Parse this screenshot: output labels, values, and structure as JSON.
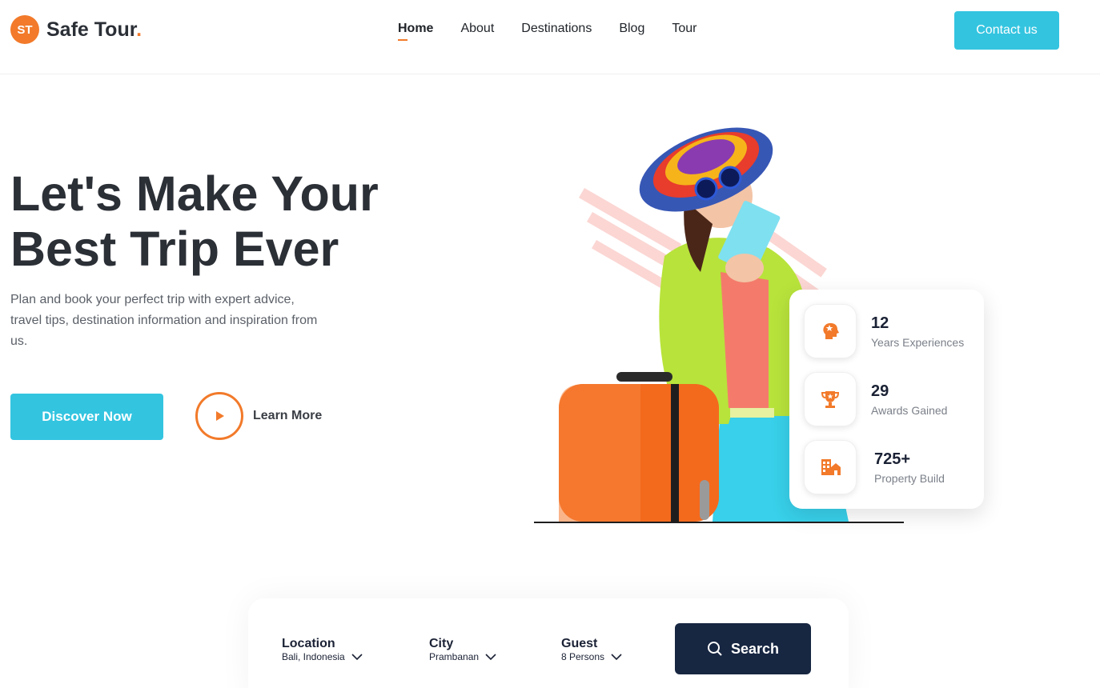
{
  "brand": {
    "badge": "ST",
    "name": "Safe Tour",
    "dot": ".",
    "accent": "#f27a2a",
    "primary": "#33c4e0",
    "dark": "#172641"
  },
  "nav": {
    "items": [
      {
        "label": "Home",
        "active": true
      },
      {
        "label": "About"
      },
      {
        "label": "Destinations"
      },
      {
        "label": "Blog"
      },
      {
        "label": "Tour"
      }
    ]
  },
  "header": {
    "contact_label": "Contact us"
  },
  "hero": {
    "title_line1": "Let's Make Your",
    "title_line2": "Best Trip Ever",
    "description": "Plan and book your perfect trip with expert advice, travel tips, destination information and inspiration from us.",
    "discover_label": "Discover Now",
    "learn_label": "Learn More"
  },
  "stats": [
    {
      "value": "12",
      "label": "Years Experiences",
      "icon": "head-star-icon"
    },
    {
      "value": "29",
      "label": "Awards Gained",
      "icon": "trophy-icon"
    },
    {
      "value": "725+",
      "label": "Property Build",
      "icon": "building-icon"
    }
  ],
  "search": {
    "location": {
      "title": "Location",
      "value": "Bali, Indonesia"
    },
    "city": {
      "title": "City",
      "value": "Prambanan"
    },
    "guest": {
      "title": "Guest",
      "value": "8 Persons"
    },
    "button_label": "Search"
  }
}
